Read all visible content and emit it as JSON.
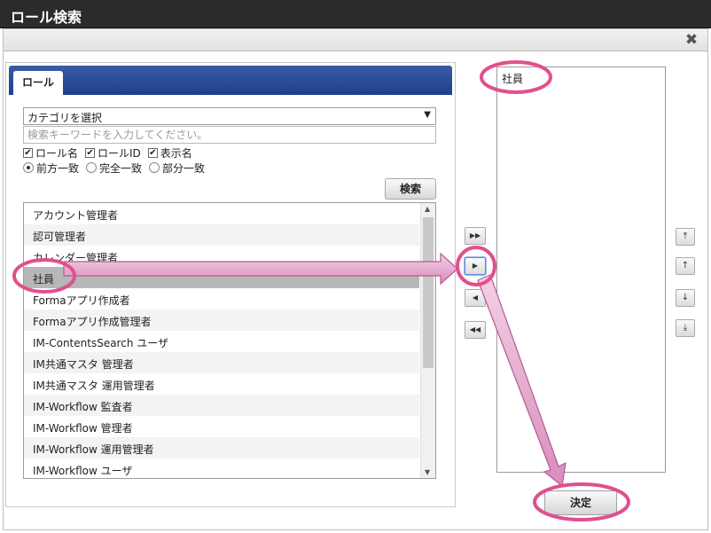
{
  "window": {
    "title": "ロール検索",
    "close_symbol": "✖"
  },
  "tabs": [
    {
      "label": "ロール"
    }
  ],
  "filter": {
    "category_value": "カテゴリを選択",
    "search_placeholder": "検索キーワードを入力してください。",
    "checkboxes": [
      {
        "label": "ロール名",
        "checked": true
      },
      {
        "label": "ロールID",
        "checked": true
      },
      {
        "label": "表示名",
        "checked": true
      }
    ],
    "match_modes": [
      {
        "label": "前方一致",
        "selected": true
      },
      {
        "label": "完全一致",
        "selected": false
      },
      {
        "label": "部分一致",
        "selected": false
      }
    ],
    "search_button": "検索"
  },
  "role_list": [
    "アカウント管理者",
    "認可管理者",
    "カレンダー管理者",
    "社員",
    "Formaアプリ作成者",
    "Formaアプリ作成管理者",
    "IM-ContentsSearch ユーザ",
    "IM共通マスタ 管理者",
    "IM共通マスタ 運用管理者",
    "IM-Workflow 監査者",
    "IM-Workflow 管理者",
    "IM-Workflow 運用管理者",
    "IM-Workflow ユーザ"
  ],
  "selected_role_index": 3,
  "move_buttons": {
    "add_all": "▶▶",
    "add": "▶",
    "remove": "◀",
    "remove_all": "◀◀"
  },
  "selected_list": [
    "社員"
  ],
  "order_buttons": {
    "top": "⤒",
    "up": "↑",
    "down": "↓",
    "bottom": "⤓"
  },
  "decide_button": "決定",
  "colors": {
    "highlight": "#e0508c",
    "arrow": "#e8a8cf",
    "tab_bar": "#1e3f8c"
  }
}
